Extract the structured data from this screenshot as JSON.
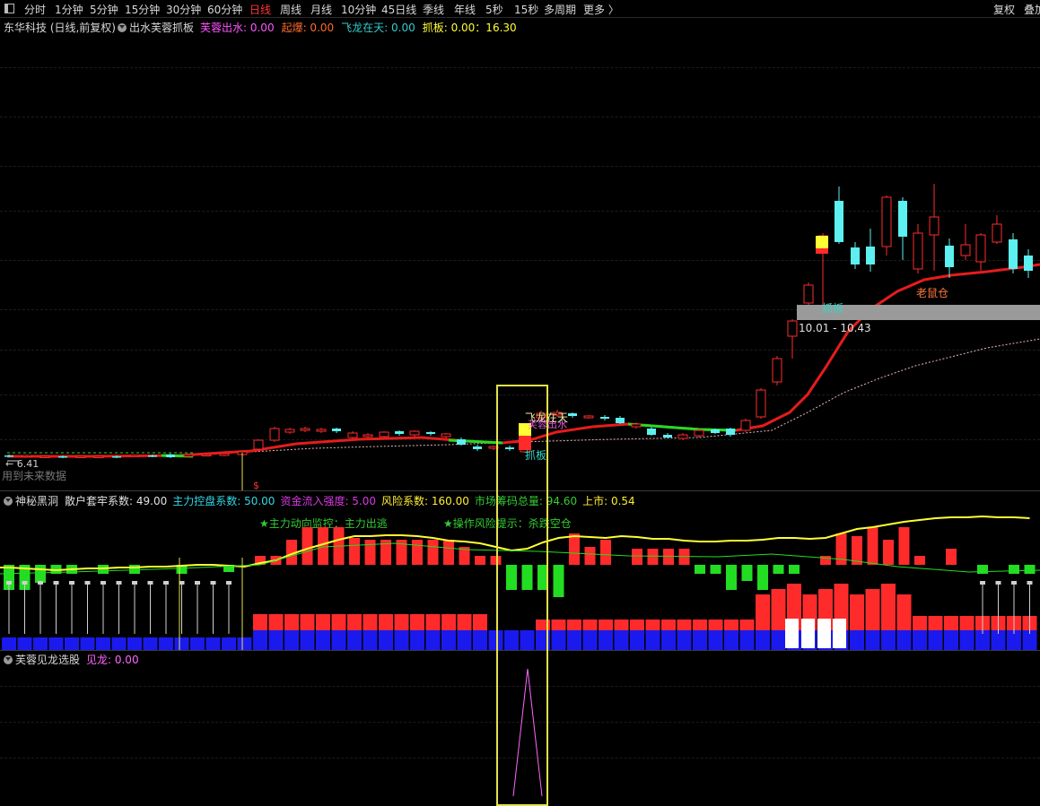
{
  "topbar": {
    "periods": [
      "分时",
      "1分钟",
      "5分钟",
      "15分钟",
      "30分钟",
      "60分钟",
      "日线",
      "周线",
      "月线",
      "10分钟",
      "45日线",
      "季线",
      "年线",
      "5秒",
      "15秒",
      "多周期",
      "更多 〉"
    ],
    "active": "日线",
    "right": [
      "复权",
      "叠加"
    ]
  },
  "main": {
    "stock": "东华科技 (日线,前复权)",
    "indicator": "出水芙蓉抓板",
    "items": [
      {
        "label": "芙蓉出水: 0.00",
        "color": "#ff55ff"
      },
      {
        "label": "起爆: 0.00",
        "color": "#ff6a2a"
      },
      {
        "label": "飞龙在天: 0.00",
        "color": "#33cccc"
      },
      {
        "label": "抓板: 0.00：16.30",
        "color": "#ffff33"
      }
    ],
    "price_low_label": "← 6.41",
    "future_label": "用到未来数据",
    "zhuaban_label": "抓板",
    "zhuaban_small": "抓板",
    "range_label": "10.01 - 10.43",
    "laoshucang": "老鼠仓",
    "feilong": "飞龙在天",
    "furong": "芙蓉出水",
    "dollar": "$"
  },
  "sub1": {
    "title": "神秘黑洞",
    "items": [
      {
        "label": "散户套牢系数: 49.00",
        "color": "#e0e0e0"
      },
      {
        "label": "主力控盘系数: 50.00",
        "color": "#33d6e6"
      },
      {
        "label": "资金流入强度: 5.00",
        "color": "#d63ae0"
      },
      {
        "label": "风险系数: 160.00",
        "color": "#ffee33"
      },
      {
        "label": "市场筹码总量: 94.60",
        "color": "#33cc33"
      },
      {
        "label": "上市: 0.54",
        "color": "#ffee33"
      }
    ],
    "note1": "★主力动向监控：主力出逃",
    "note2": "★操作风险提示：杀跌空仓"
  },
  "sub2": {
    "title": "芙蓉见龙选股",
    "item": "见龙: 0.00"
  },
  "colors": {
    "up": "#ff2b2b",
    "down": "#5cf0f0",
    "ma": "#e51c1c",
    "yellow": "#ffff33",
    "green": "#22dd22",
    "blue": "#1a1aee",
    "magenta": "#ff66ff"
  }
}
